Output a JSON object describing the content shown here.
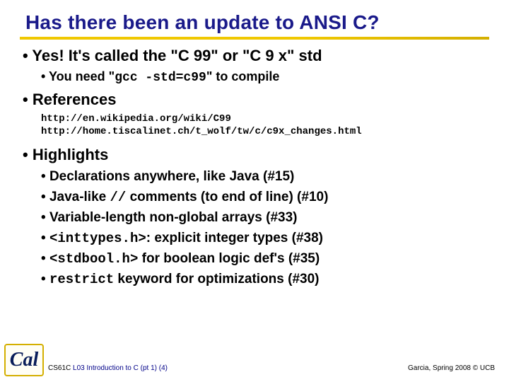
{
  "title": "Has there been an update to ANSI C?",
  "b1": {
    "text_a": "Yes! It's called the \"C 99\" or \"C 9 x\" std",
    "sub_a1_pre": "You need \"",
    "sub_a1_code": "gcc -std=c99",
    "sub_a1_post": "\" to compile"
  },
  "b2": {
    "text": "References",
    "ref1": "http://en.wikipedia.org/wiki/C99",
    "ref2": "http://home.tiscalinet.ch/t_wolf/tw/c/c9x_changes.html"
  },
  "b3": {
    "text": "Highlights",
    "h1": "Declarations anywhere, like Java (#15)",
    "h2_pre": "Java-like ",
    "h2_code": "//",
    "h2_post": " comments (to end of line) (#10)",
    "h3": "Variable-length non-global arrays (#33)",
    "h4_code": "<inttypes.h>",
    "h4_post": ": explicit integer types (#38)",
    "h5_code": "<stdbool.h>",
    "h5_post": " for boolean logic def's (#35)",
    "h6_code": "restrict",
    "h6_post": " keyword for optimizations (#30)"
  },
  "footer": {
    "course": "CS61C",
    "lecture": "L03 Introduction to C (pt 1) ",
    "page": "(4)",
    "right": "Garcia, Spring 2008 © UCB"
  },
  "logo_text": "Cal"
}
